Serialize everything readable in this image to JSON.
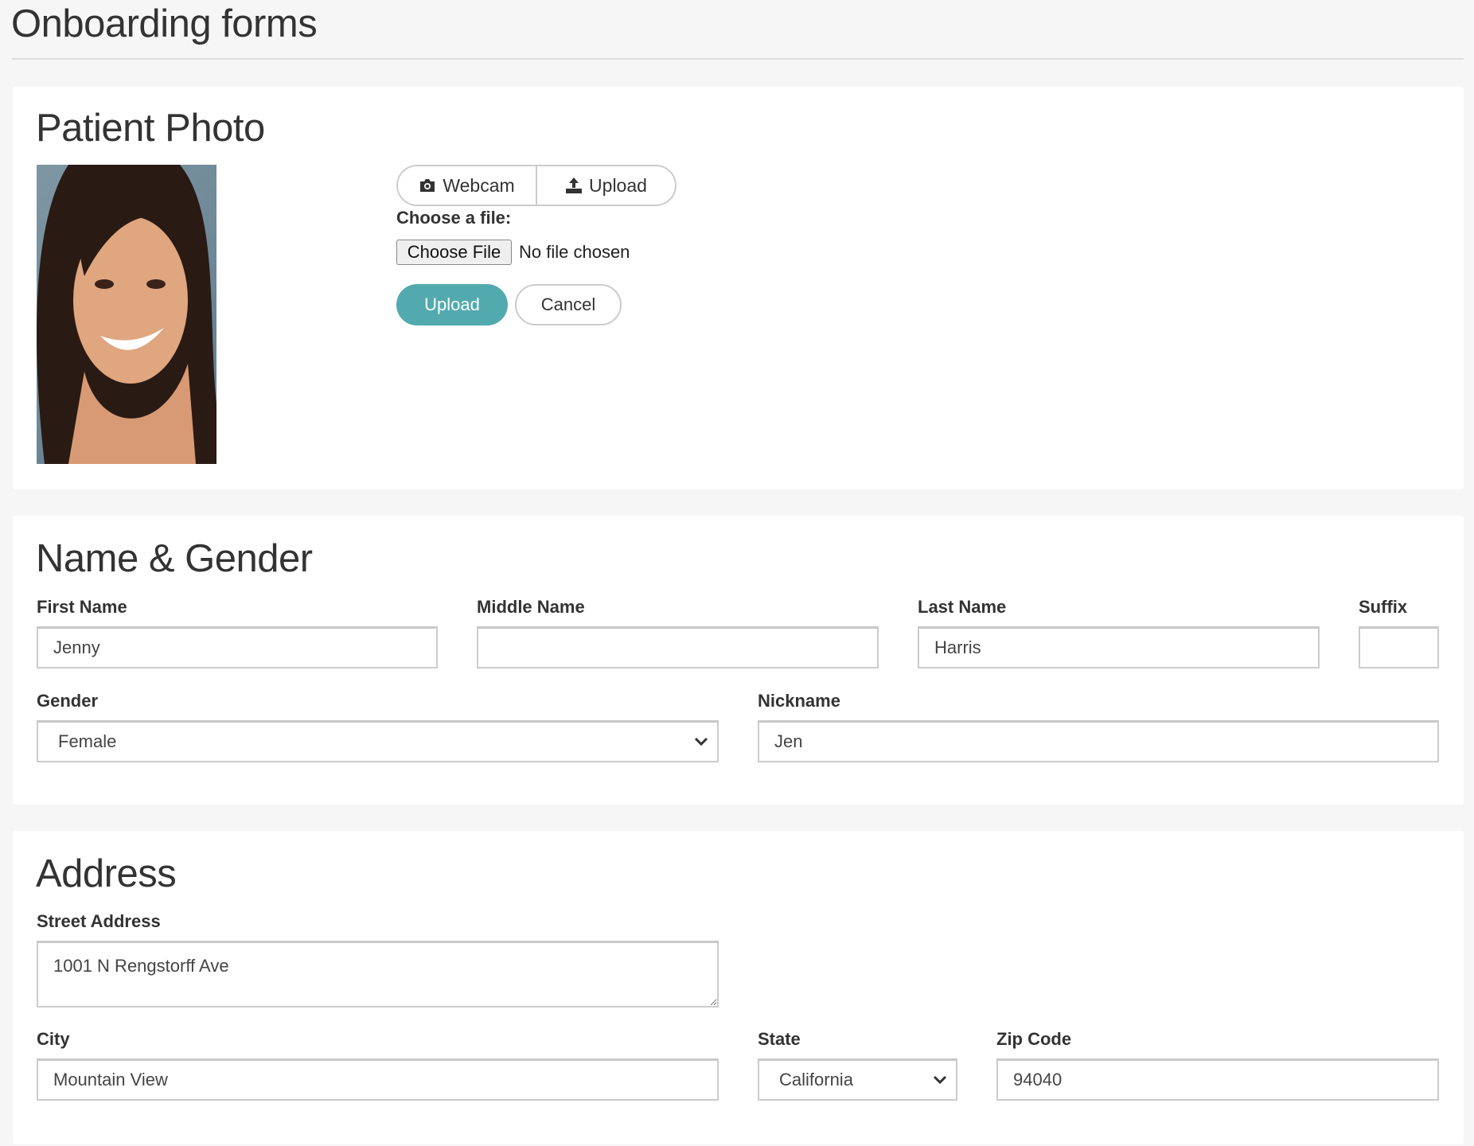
{
  "page": {
    "title": "Onboarding forms"
  },
  "patient_photo": {
    "heading": "Patient Photo",
    "tabs": [
      {
        "label": "Webcam",
        "icon": "camera-icon"
      },
      {
        "label": "Upload",
        "icon": "upload-icon"
      }
    ],
    "choose_label": "Choose a file:",
    "choose_file_button": "Choose File",
    "file_status": "No file chosen",
    "upload_button": "Upload",
    "cancel_button": "Cancel",
    "accent_color": "#52aaae"
  },
  "name_gender": {
    "heading": "Name & Gender",
    "first_name": {
      "label": "First Name",
      "value": "Jenny"
    },
    "middle_name": {
      "label": "Middle Name",
      "value": ""
    },
    "last_name": {
      "label": "Last Name",
      "value": "Harris"
    },
    "suffix": {
      "label": "Suffix",
      "value": ""
    },
    "gender": {
      "label": "Gender",
      "value": "Female"
    },
    "nickname": {
      "label": "Nickname",
      "value": "Jen"
    }
  },
  "address": {
    "heading": "Address",
    "street": {
      "label": "Street Address",
      "value": "1001 N Rengstorff Ave"
    },
    "city": {
      "label": "City",
      "value": "Mountain View"
    },
    "state": {
      "label": "State",
      "value": "California"
    },
    "zip": {
      "label": "Zip Code",
      "value": "94040"
    }
  }
}
